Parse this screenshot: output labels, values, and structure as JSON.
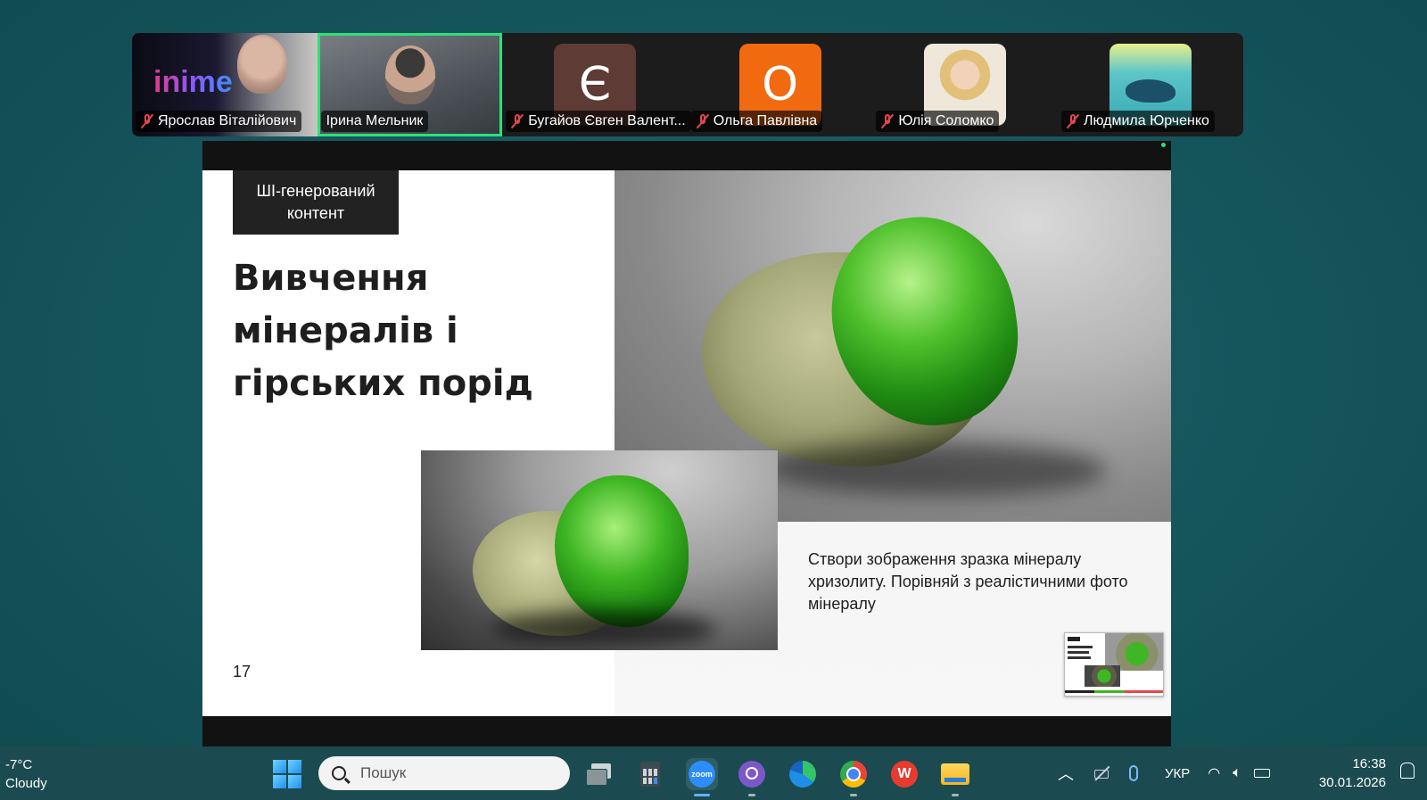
{
  "participants": [
    {
      "name": "Ярослав Віталійович",
      "muted": true,
      "type": "video",
      "overlay_text": "inime"
    },
    {
      "name": "Ірина Мельник",
      "muted": false,
      "type": "video",
      "active_speaker": true
    },
    {
      "name": "Бугайов Євген Валент...",
      "muted": true,
      "type": "initial",
      "initial": "Є",
      "color": "#5e3b34"
    },
    {
      "name": "Ольга Павлівна",
      "muted": true,
      "type": "initial",
      "initial": "О",
      "color": "#f26a10"
    },
    {
      "name": "Юлія Соломко",
      "muted": true,
      "type": "photo"
    },
    {
      "name": "Людмила Юрченко",
      "muted": true,
      "type": "photo"
    }
  ],
  "slide": {
    "badge": "ШІ-генерований контент",
    "title": "Вивчення мінералів і гірських порід",
    "caption": "Створи зображення зразка мінералу хризолиту. Порівняй з реалістичними фото мінералу",
    "page_number": "17"
  },
  "taskbar": {
    "weather_temp": "-7°C",
    "weather_desc": "Cloudy",
    "search_placeholder": "Пошук",
    "apps": [
      "task-view",
      "calculator",
      "zoom",
      "viber",
      "edge",
      "chrome",
      "wps",
      "file-explorer"
    ],
    "zoom_label": "zoom",
    "language": "УКР",
    "time": "16:38",
    "date": "30.01.2026"
  },
  "colors": {
    "active_speaker_border": "#2ee07a",
    "muted_icon": "#e5484d",
    "desktop_bg": "#16585f"
  }
}
